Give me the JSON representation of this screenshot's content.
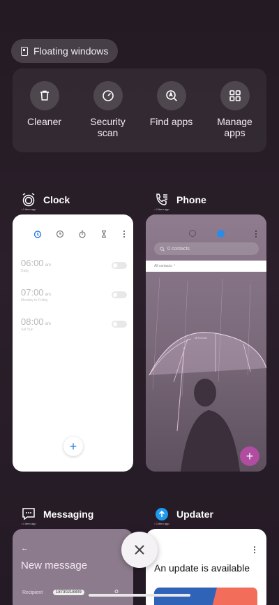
{
  "floating": {
    "label": "Floating windows"
  },
  "quick_actions": [
    {
      "label": "Cleaner",
      "icon": "trash-icon"
    },
    {
      "label": "Security\nscan",
      "icon": "gauge-icon"
    },
    {
      "label": "Find apps",
      "icon": "search-app-icon"
    },
    {
      "label": "Manage\napps",
      "icon": "grid-icon"
    }
  ],
  "apps": {
    "clock": {
      "name": "Clock",
      "tag": "1 item app",
      "alarms": [
        {
          "time": "06:00",
          "ampm": "am",
          "days": "Daily"
        },
        {
          "time": "07:00",
          "ampm": "am",
          "days": "Monday to Friday"
        },
        {
          "time": "08:00",
          "ampm": "am",
          "days": "Sat Sun"
        }
      ]
    },
    "phone": {
      "name": "Phone",
      "tag": "1 item app",
      "search_placeholder": "0 contacts",
      "filter": "All contacts",
      "watermark": "MiTUHUN"
    },
    "messaging": {
      "name": "Messaging",
      "tag": "1 item app",
      "title": "New message",
      "recipient_label": "Recipient",
      "recipient_value": "18730218809"
    },
    "updater": {
      "name": "Updater",
      "tag": "1 item app",
      "title": "An update is available"
    }
  },
  "colors": {
    "accent": "#2a7de1",
    "phone_fab": "#b04da0"
  }
}
